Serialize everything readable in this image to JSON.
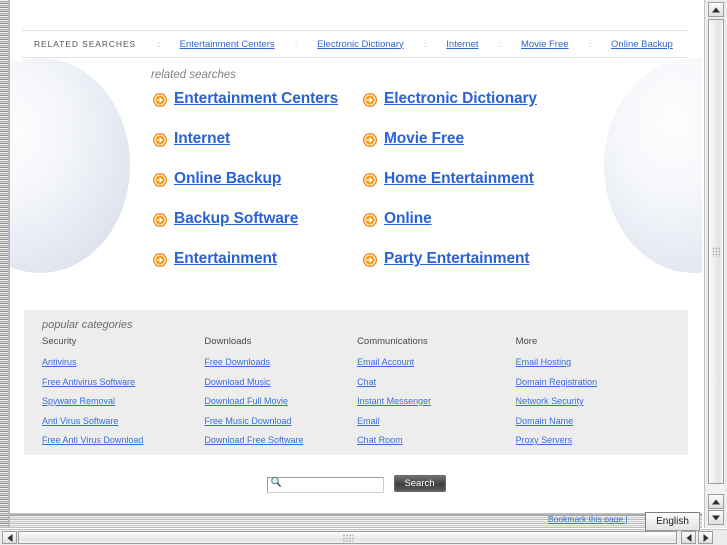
{
  "topstrip": {
    "label": "RELATED SEARCHES",
    "separator": "::",
    "links": [
      "Entertainment Centers",
      "Electronic Dictionary",
      "Internet",
      "Movie Free",
      "Online Backup"
    ]
  },
  "related": {
    "heading": "related searches",
    "icon": "arrow-circle-right-icon",
    "links": [
      "Entertainment Centers",
      "Electronic Dictionary",
      "Internet",
      "Movie Free",
      "Online Backup",
      "Home Entertainment",
      "Backup Software",
      "Online",
      "Entertainment",
      "Party Entertainment"
    ]
  },
  "categories": {
    "title": "popular categories",
    "columns": [
      {
        "head": "Security",
        "links": [
          "Antivirus",
          "Free Antivirus Software",
          "Spyware Removal",
          "Anti Virus Software",
          "Free Anti Virus Download"
        ]
      },
      {
        "head": "Downloads",
        "links": [
          "Free Downloads",
          "Download Music",
          "Download Full Movie",
          "Free Music Download",
          "Download Free Software"
        ]
      },
      {
        "head": "Communications",
        "links": [
          "Email Account",
          "Chat",
          "Instant Messenger",
          "Email",
          "Chat Room"
        ]
      },
      {
        "head": "More",
        "links": [
          "Email Hosting",
          "Domain Registration",
          "Network Security",
          "Domain Name",
          "Proxy Servers"
        ]
      }
    ]
  },
  "search": {
    "value": "",
    "placeholder": "",
    "icon": "magnifier-icon",
    "button_label": "Search"
  },
  "statusbar": {
    "bookmark_label": "Bookmark this page |",
    "language_value": "English"
  },
  "colors": {
    "link_blue": "#3366cc",
    "main_link_blue": "#2b62d6",
    "arrow_orange": "#f08a12",
    "panel_gray": "#ededed",
    "heading_gray": "#808080"
  }
}
